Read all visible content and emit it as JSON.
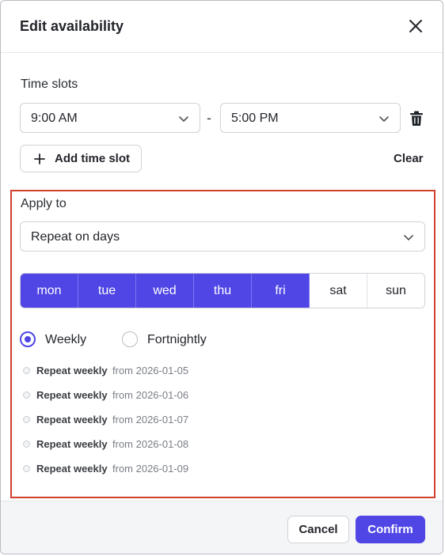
{
  "dialog": {
    "title": "Edit availability"
  },
  "icons": {
    "close": "close-icon",
    "chevron": "chevron-down-icon",
    "trash": "trash-icon",
    "plus": "plus-icon"
  },
  "time_slots": {
    "label": "Time slots",
    "start": "9:00 AM",
    "separator": "-",
    "end": "5:00 PM",
    "add_label": "Add time slot",
    "clear_label": "Clear"
  },
  "apply_to": {
    "label": "Apply to",
    "selected": "Repeat on days",
    "days": [
      {
        "label": "mon",
        "selected": true
      },
      {
        "label": "tue",
        "selected": true
      },
      {
        "label": "wed",
        "selected": true
      },
      {
        "label": "thu",
        "selected": true
      },
      {
        "label": "fri",
        "selected": true
      },
      {
        "label": "sat",
        "selected": false
      },
      {
        "label": "sun",
        "selected": false
      }
    ],
    "frequency": {
      "weekly": "Weekly",
      "fortnightly": "Fortnightly",
      "selected": "Weekly"
    },
    "repeats": [
      {
        "label": "Repeat weekly",
        "from": "from 2026-01-05"
      },
      {
        "label": "Repeat weekly",
        "from": "from 2026-01-06"
      },
      {
        "label": "Repeat weekly",
        "from": "from 2026-01-07"
      },
      {
        "label": "Repeat weekly",
        "from": "from 2026-01-08"
      },
      {
        "label": "Repeat weekly",
        "from": "from 2026-01-09"
      }
    ]
  },
  "footer": {
    "cancel": "Cancel",
    "confirm": "Confirm"
  },
  "colors": {
    "accent": "#4f46e5",
    "highlight_border": "#d0402b"
  }
}
